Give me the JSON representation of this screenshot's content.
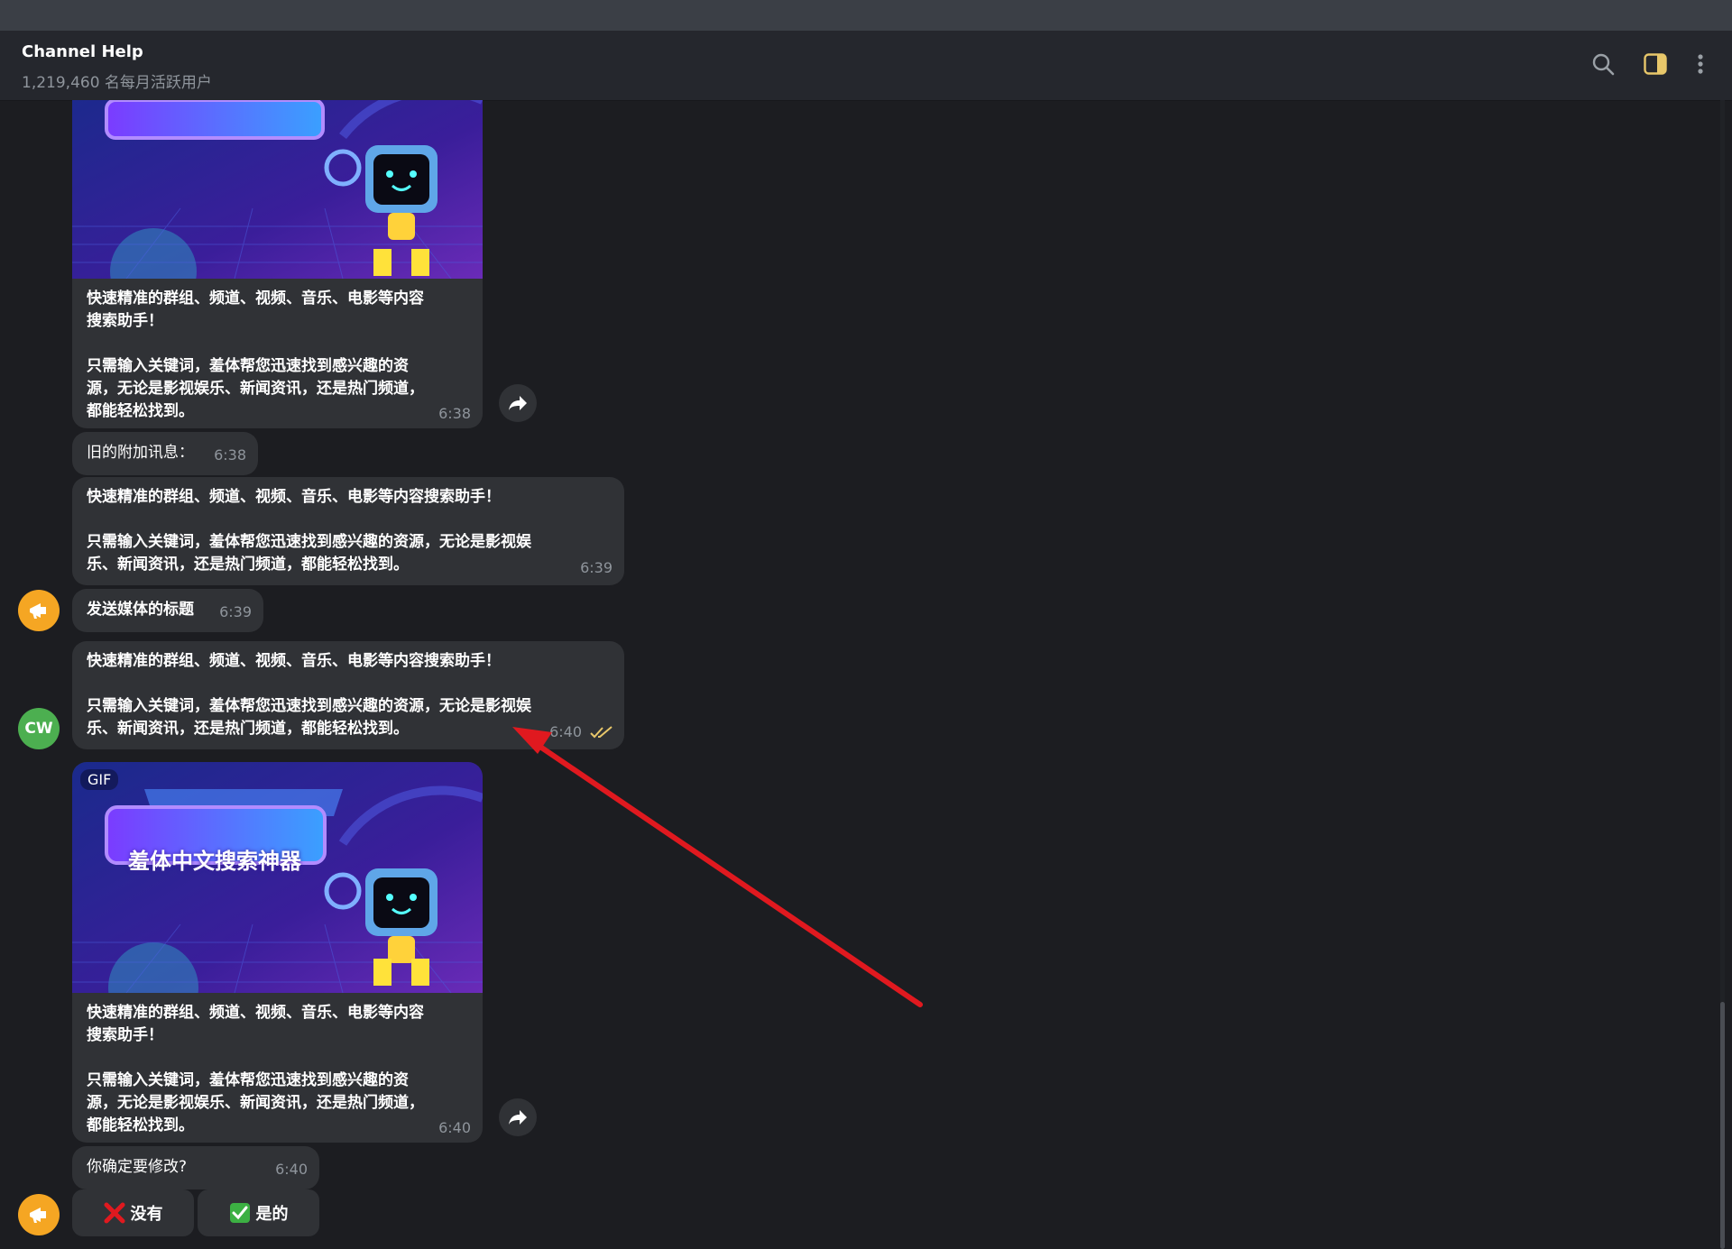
{
  "header": {
    "title": "Channel Help",
    "subtitle": "1,219,460 名每月活跃用户",
    "icons": [
      "search-icon",
      "sidebar-toggle-icon",
      "more-vertical-icon"
    ]
  },
  "media_banner": {
    "badge": "GIF",
    "caption": "羞体中文搜索神器"
  },
  "messages": [
    {
      "text": "快速精准的群组、频道、视频、音乐、电影等内容\n搜索助手！\n\n只需输入关键词，羞体帮您迅速找到感兴趣的资\n源，无论是影视娱乐、新闻资讯，还是热门频道，\n都能轻松找到。",
      "time": "6:38"
    },
    {
      "text": "旧的附加讯息：",
      "time": "6:38"
    },
    {
      "text": "快速精准的群组、频道、视频、音乐、电影等内容搜索助手！\n\n只需输入关键词，羞体帮您迅速找到感兴趣的资源，无论是影视娱\n乐、新闻资讯，还是热门频道，都能轻松找到。",
      "time": "6:39"
    },
    {
      "text": "发送媒体的标题",
      "time": "6:39"
    },
    {
      "text": "快速精准的群组、频道、视频、音乐、电影等内容搜索助手！\n\n只需输入关键词，羞体帮您迅速找到感兴趣的资源，无论是影视娱\n乐、新闻资讯，还是热门频道，都能轻松找到。",
      "time": "6:40"
    },
    {
      "text": "快速精准的群组、频道、视频、音乐、电影等内容\n搜索助手！\n\n只需输入关键词，羞体帮您迅速找到感兴趣的资\n源，无论是影视娱乐、新闻资讯，还是热门频道，\n都能轻松找到。",
      "time": "6:40"
    },
    {
      "text": "你确定要修改?",
      "time": "6:40"
    }
  ],
  "avatars": {
    "user_initials": "CW",
    "bot_icon": "megaphone-icon",
    "bot_color": "#f5a623",
    "user_color": "#4caf50"
  },
  "keyboard": {
    "no_label": "没有",
    "yes_label": "是的"
  },
  "colors": {
    "background": "#1c1d21",
    "bubble": "#303236",
    "header": "#25272d",
    "accent_check": "#e8c76a",
    "annotation_arrow": "#e0191f"
  }
}
